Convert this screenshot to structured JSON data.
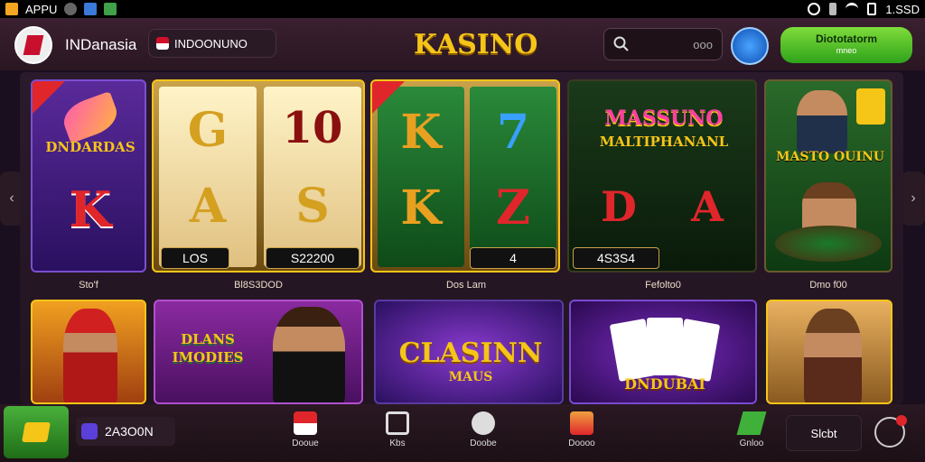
{
  "status_bar": {
    "app_label": "APPU",
    "time": "1.SSD"
  },
  "header": {
    "brand": "INDanasia",
    "language": "INDOONUNO",
    "title": "KASINO",
    "search_placeholder": "ooo",
    "login": {
      "label": "Diototatorm",
      "sub": "mneo"
    }
  },
  "games": [
    {
      "title": "DNDARDAS",
      "letter": "K",
      "caption": "Sto'f"
    },
    {
      "letters": [
        "G",
        "10",
        "A",
        "S"
      ],
      "values": [
        "LOS",
        "S22200"
      ],
      "caption": "Bl8S3DOD"
    },
    {
      "letters": [
        "K",
        "7",
        "K",
        "Z"
      ],
      "values": [
        "4"
      ],
      "caption": "Dos Lam"
    },
    {
      "title": "MASSUNO",
      "subtitle": "MALTIPHANANL",
      "letters": [
        "D",
        "A"
      ],
      "values": [
        "4S3S4"
      ],
      "caption": "Fefolto0"
    },
    {
      "title": "MASTO OUINU",
      "caption": "Dmo f00"
    }
  ],
  "games_row2": [
    {
      "title": "DLANS IMODIES"
    },
    {
      "title": "CLASINN",
      "subtitle": "MAUS"
    },
    {
      "title": "DNDUBAI"
    }
  ],
  "bottom_nav": {
    "balance": "2A3O0N",
    "items": [
      "Dooue",
      "Kbs",
      "Doobe",
      "Doooo",
      "Gnloo"
    ],
    "shop": "Slcbt"
  },
  "colors": {
    "accent": "#f5c518",
    "green": "#2ea31a",
    "gold": "#c9a24a"
  }
}
